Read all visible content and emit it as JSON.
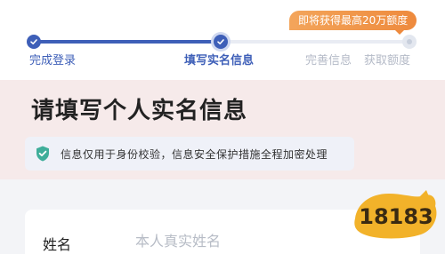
{
  "progress": {
    "promo_badge": "即将获得最高20万额度",
    "steps": [
      {
        "label": "完成登录",
        "state": "done"
      },
      {
        "label": "填写实名信息",
        "state": "current"
      },
      {
        "label": "完善信息",
        "state": "todo"
      },
      {
        "label": "获取额度",
        "state": "todo"
      }
    ]
  },
  "page": {
    "title": "请填写个人实名信息",
    "notice": "信息仅用于身份校验，信息安全保护措施全程加密处理"
  },
  "form": {
    "name_label": "姓名",
    "name_placeholder": "本人真实姓名"
  },
  "logo": {
    "text": "18183"
  },
  "colors": {
    "accent": "#3e5fb8",
    "promo": "#ee8a3d",
    "shield": "#3fae9a",
    "logo": "#f2b22a"
  }
}
